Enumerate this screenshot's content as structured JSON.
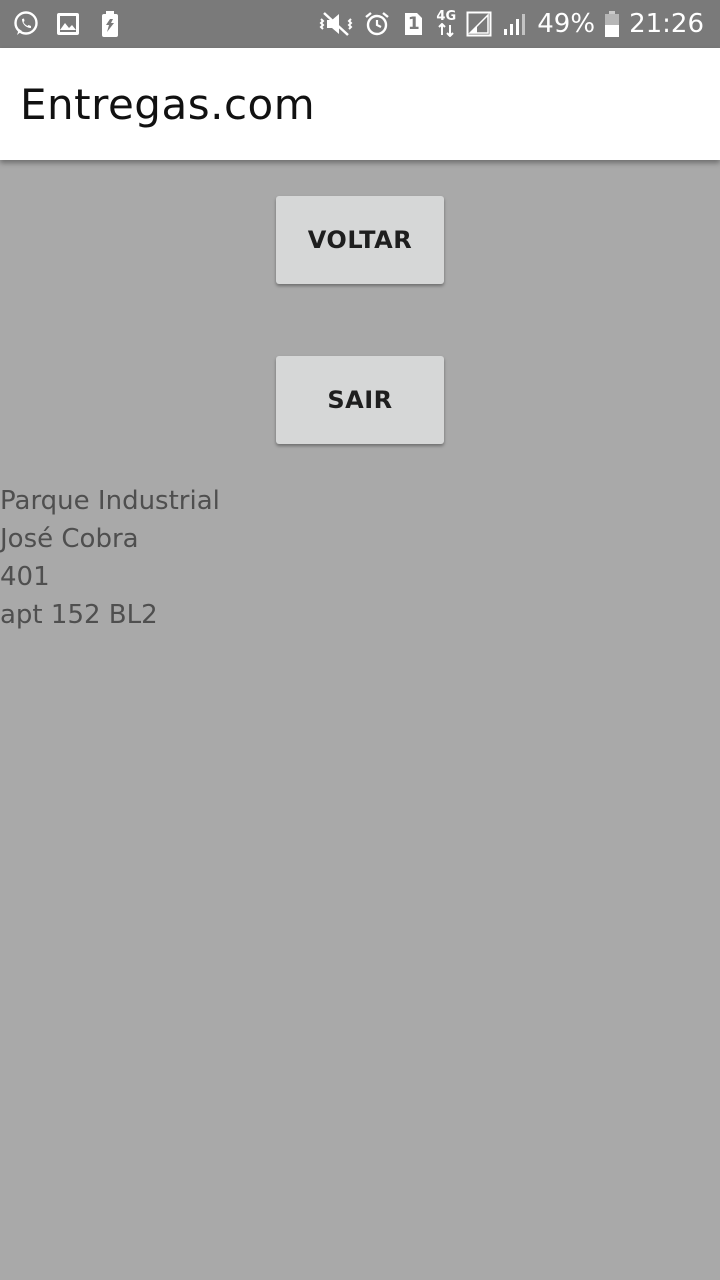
{
  "status_bar": {
    "left_icons": [
      "whatsapp-icon",
      "gallery-icon",
      "battery-saver-icon"
    ],
    "right_icons": [
      "mute-vibrate-icon",
      "alarm-icon",
      "sim-1-icon",
      "network-4g-icon",
      "signal-sim1-icon",
      "signal-sim2-icon",
      "battery-icon"
    ],
    "sim_label": "1",
    "network_label": "4G",
    "battery_percent": "49%",
    "time": "21:26"
  },
  "app_bar": {
    "title": "Entregas.com"
  },
  "buttons": {
    "voltar_label": "VOLTAR",
    "sair_label": "SAIR"
  },
  "address": {
    "line1": "Parque Industrial",
    "line2": "José Cobra",
    "line3": "401",
    "line4": "apt 152 BL2"
  },
  "colors": {
    "background": "#a9a9a9",
    "status_bar": "#7a7a7a",
    "app_bar": "#ffffff",
    "button": "#d6d7d7",
    "text": "#4f4f4f"
  }
}
